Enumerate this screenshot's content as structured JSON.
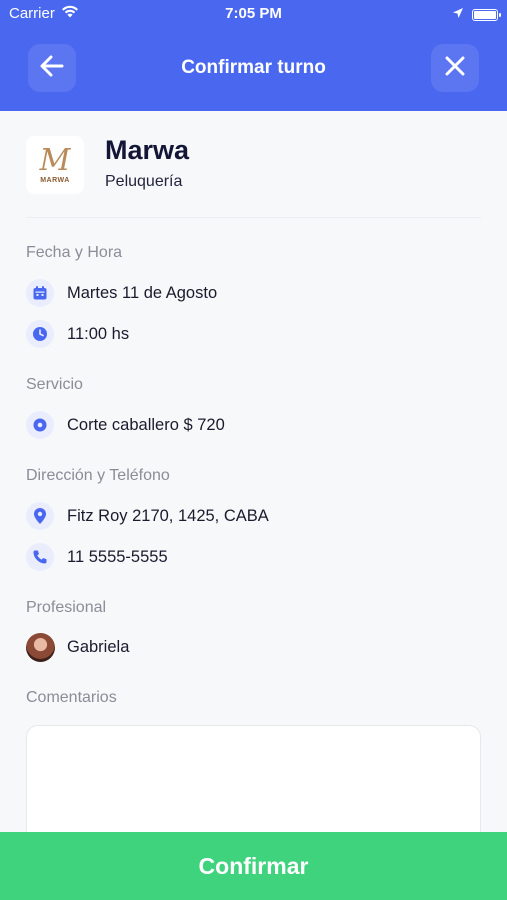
{
  "status_bar": {
    "carrier": "Carrier",
    "time": "7:05 PM"
  },
  "header": {
    "title": "Confirmar turno",
    "back_icon": "arrow-left-icon",
    "close_icon": "close-icon",
    "background_color": "#4a67f0"
  },
  "business": {
    "name": "Marwa",
    "category": "Peluquería",
    "logo_text": "MARWA",
    "logo_initial": "M"
  },
  "sections": {
    "datetime": {
      "label": "Fecha y Hora",
      "date": "Martes 11 de Agosto",
      "time": "11:00 hs"
    },
    "service": {
      "label": "Servicio",
      "value": "Corte caballero $ 720"
    },
    "contact": {
      "label": "Dirección y Teléfono",
      "address": "Fitz Roy 2170, 1425, CABA",
      "phone": "11 5555-5555"
    },
    "professional": {
      "label": "Profesional",
      "name": "Gabriela"
    },
    "comments": {
      "label": "Comentarios",
      "value": ""
    }
  },
  "confirm_button": {
    "label": "Confirmar",
    "color": "#3fd37e"
  },
  "accent_color": "#4a67f0"
}
